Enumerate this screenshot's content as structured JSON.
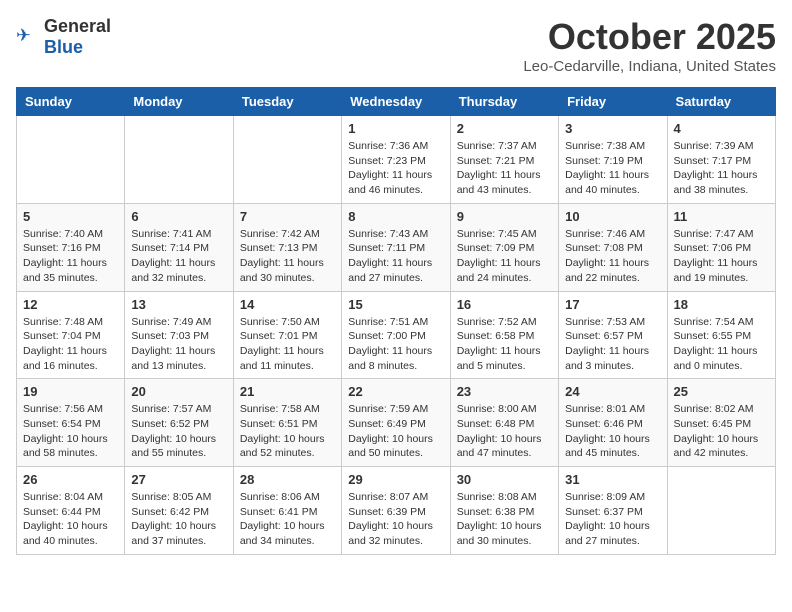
{
  "header": {
    "logo_general": "General",
    "logo_blue": "Blue",
    "month": "October 2025",
    "location": "Leo-Cedarville, Indiana, United States"
  },
  "days_of_week": [
    "Sunday",
    "Monday",
    "Tuesday",
    "Wednesday",
    "Thursday",
    "Friday",
    "Saturday"
  ],
  "weeks": [
    [
      {
        "day": "",
        "info": ""
      },
      {
        "day": "",
        "info": ""
      },
      {
        "day": "",
        "info": ""
      },
      {
        "day": "1",
        "info": "Sunrise: 7:36 AM\nSunset: 7:23 PM\nDaylight: 11 hours\nand 46 minutes."
      },
      {
        "day": "2",
        "info": "Sunrise: 7:37 AM\nSunset: 7:21 PM\nDaylight: 11 hours\nand 43 minutes."
      },
      {
        "day": "3",
        "info": "Sunrise: 7:38 AM\nSunset: 7:19 PM\nDaylight: 11 hours\nand 40 minutes."
      },
      {
        "day": "4",
        "info": "Sunrise: 7:39 AM\nSunset: 7:17 PM\nDaylight: 11 hours\nand 38 minutes."
      }
    ],
    [
      {
        "day": "5",
        "info": "Sunrise: 7:40 AM\nSunset: 7:16 PM\nDaylight: 11 hours\nand 35 minutes."
      },
      {
        "day": "6",
        "info": "Sunrise: 7:41 AM\nSunset: 7:14 PM\nDaylight: 11 hours\nand 32 minutes."
      },
      {
        "day": "7",
        "info": "Sunrise: 7:42 AM\nSunset: 7:13 PM\nDaylight: 11 hours\nand 30 minutes."
      },
      {
        "day": "8",
        "info": "Sunrise: 7:43 AM\nSunset: 7:11 PM\nDaylight: 11 hours\nand 27 minutes."
      },
      {
        "day": "9",
        "info": "Sunrise: 7:45 AM\nSunset: 7:09 PM\nDaylight: 11 hours\nand 24 minutes."
      },
      {
        "day": "10",
        "info": "Sunrise: 7:46 AM\nSunset: 7:08 PM\nDaylight: 11 hours\nand 22 minutes."
      },
      {
        "day": "11",
        "info": "Sunrise: 7:47 AM\nSunset: 7:06 PM\nDaylight: 11 hours\nand 19 minutes."
      }
    ],
    [
      {
        "day": "12",
        "info": "Sunrise: 7:48 AM\nSunset: 7:04 PM\nDaylight: 11 hours\nand 16 minutes."
      },
      {
        "day": "13",
        "info": "Sunrise: 7:49 AM\nSunset: 7:03 PM\nDaylight: 11 hours\nand 13 minutes."
      },
      {
        "day": "14",
        "info": "Sunrise: 7:50 AM\nSunset: 7:01 PM\nDaylight: 11 hours\nand 11 minutes."
      },
      {
        "day": "15",
        "info": "Sunrise: 7:51 AM\nSunset: 7:00 PM\nDaylight: 11 hours\nand 8 minutes."
      },
      {
        "day": "16",
        "info": "Sunrise: 7:52 AM\nSunset: 6:58 PM\nDaylight: 11 hours\nand 5 minutes."
      },
      {
        "day": "17",
        "info": "Sunrise: 7:53 AM\nSunset: 6:57 PM\nDaylight: 11 hours\nand 3 minutes."
      },
      {
        "day": "18",
        "info": "Sunrise: 7:54 AM\nSunset: 6:55 PM\nDaylight: 11 hours\nand 0 minutes."
      }
    ],
    [
      {
        "day": "19",
        "info": "Sunrise: 7:56 AM\nSunset: 6:54 PM\nDaylight: 10 hours\nand 58 minutes."
      },
      {
        "day": "20",
        "info": "Sunrise: 7:57 AM\nSunset: 6:52 PM\nDaylight: 10 hours\nand 55 minutes."
      },
      {
        "day": "21",
        "info": "Sunrise: 7:58 AM\nSunset: 6:51 PM\nDaylight: 10 hours\nand 52 minutes."
      },
      {
        "day": "22",
        "info": "Sunrise: 7:59 AM\nSunset: 6:49 PM\nDaylight: 10 hours\nand 50 minutes."
      },
      {
        "day": "23",
        "info": "Sunrise: 8:00 AM\nSunset: 6:48 PM\nDaylight: 10 hours\nand 47 minutes."
      },
      {
        "day": "24",
        "info": "Sunrise: 8:01 AM\nSunset: 6:46 PM\nDaylight: 10 hours\nand 45 minutes."
      },
      {
        "day": "25",
        "info": "Sunrise: 8:02 AM\nSunset: 6:45 PM\nDaylight: 10 hours\nand 42 minutes."
      }
    ],
    [
      {
        "day": "26",
        "info": "Sunrise: 8:04 AM\nSunset: 6:44 PM\nDaylight: 10 hours\nand 40 minutes."
      },
      {
        "day": "27",
        "info": "Sunrise: 8:05 AM\nSunset: 6:42 PM\nDaylight: 10 hours\nand 37 minutes."
      },
      {
        "day": "28",
        "info": "Sunrise: 8:06 AM\nSunset: 6:41 PM\nDaylight: 10 hours\nand 34 minutes."
      },
      {
        "day": "29",
        "info": "Sunrise: 8:07 AM\nSunset: 6:39 PM\nDaylight: 10 hours\nand 32 minutes."
      },
      {
        "day": "30",
        "info": "Sunrise: 8:08 AM\nSunset: 6:38 PM\nDaylight: 10 hours\nand 30 minutes."
      },
      {
        "day": "31",
        "info": "Sunrise: 8:09 AM\nSunset: 6:37 PM\nDaylight: 10 hours\nand 27 minutes."
      },
      {
        "day": "",
        "info": ""
      }
    ]
  ]
}
